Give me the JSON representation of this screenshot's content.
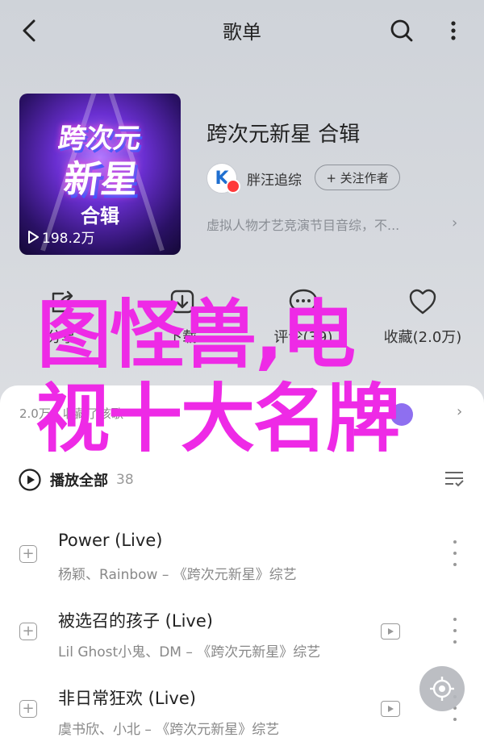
{
  "topbar": {
    "title": "歌单",
    "back_icon": "chevron-left-icon",
    "search_icon": "search-icon",
    "more_icon": "more-vertical-icon"
  },
  "album": {
    "cover_logo_line1": "跨次元",
    "cover_logo_line2": "新星",
    "cover_subtitle": "合辑",
    "plays": "198.2万",
    "title": "跨次元新星 合辑",
    "creator": "胖汪追综",
    "creator_avatar_letter": "K",
    "follow_label": "+ 关注作者",
    "description": "虚拟人物才艺竞演节目音综，不..."
  },
  "actions": [
    {
      "icon": "share-icon",
      "label": "分享"
    },
    {
      "icon": "download-icon",
      "label": "下载"
    },
    {
      "icon": "comment-icon",
      "label": "评论(39)"
    },
    {
      "icon": "heart-icon",
      "label": "收藏(2.0万)"
    }
  ],
  "sheet": {
    "comment_strip": "2.0万人收藏了该歌",
    "play_all_label": "播放全部",
    "play_all_count": "38"
  },
  "tracks": [
    {
      "title": "Power (Live)",
      "meta": "杨颖、Rainbow – 《跨次元新星》综艺",
      "has_mv": false
    },
    {
      "title": "被选召的孩子 (Live)",
      "meta": "Lil Ghost小鬼、DM – 《跨次元新星》综艺",
      "has_mv": true
    },
    {
      "title": "非日常狂欢 (Live)",
      "meta": "虞书欣、小北 – 《跨次元新星》综艺",
      "has_mv": true
    }
  ],
  "overlay": {
    "line1": "图怪兽,电",
    "line2": "视十大名牌"
  },
  "colors": {
    "overlay": "#ee2ae6",
    "header_bg": "#d3d6db",
    "text_primary": "#222222",
    "text_secondary": "#888888"
  }
}
